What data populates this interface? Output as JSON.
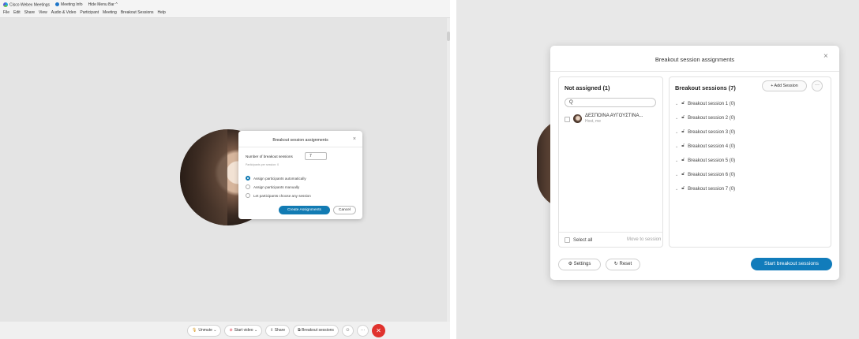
{
  "left": {
    "titlebar": {
      "app_title": "Cisco Webex Meetings",
      "meeting_info": "Meeting Info",
      "hide_menu_bar": "Hide Menu Bar ^",
      "menu": [
        "File",
        "Edit",
        "Share",
        "View",
        "Audio & Video",
        "Participant",
        "Meeting",
        "Breakout Sessions",
        "Help"
      ]
    },
    "dialog": {
      "title": "Breakout session assignments",
      "close": "×",
      "count_label": "Number of breakout sessions",
      "count_value": "7",
      "per_session": "Participants per session: 0",
      "options": [
        {
          "label": "Assign participants automatically",
          "selected": true
        },
        {
          "label": "Assign participants manually",
          "selected": false
        },
        {
          "label": "Let participants choose any session",
          "selected": false
        }
      ],
      "create": "Create Assignments",
      "cancel": "Cancel"
    },
    "toolbar": {
      "unmute": "Unmute",
      "start_video": "Start video",
      "share": "Share",
      "breakout": "Breakout sessions",
      "more": "···",
      "leave": "✕"
    }
  },
  "right": {
    "dialog": {
      "title": "Breakout session assignments",
      "close": "×",
      "not_assigned_title": "Not assigned (1)",
      "search_icon": "Q",
      "participant": {
        "name": "ΔΕΣΠΟΙΝΑ ΑΥΓΟΥΣΤΙΝΑ...",
        "role": "Host, me"
      },
      "select_all": "Select all",
      "move_to_session": "Move to session",
      "sessions_title": "Breakout sessions  (7)",
      "add_session": "+ Add Session",
      "more": "···",
      "sessions": [
        "Breakout session 1 (0)",
        "Breakout session 2 (0)",
        "Breakout session 3 (0)",
        "Breakout session 4 (0)",
        "Breakout session 5 (0)",
        "Breakout session 6 (0)",
        "Breakout session 7 (0)"
      ],
      "settings": "Settings",
      "reset": "Reset",
      "start": "Start breakout sessions"
    }
  },
  "colors": {
    "accent": "#117cbb",
    "leave": "#e0322d"
  }
}
